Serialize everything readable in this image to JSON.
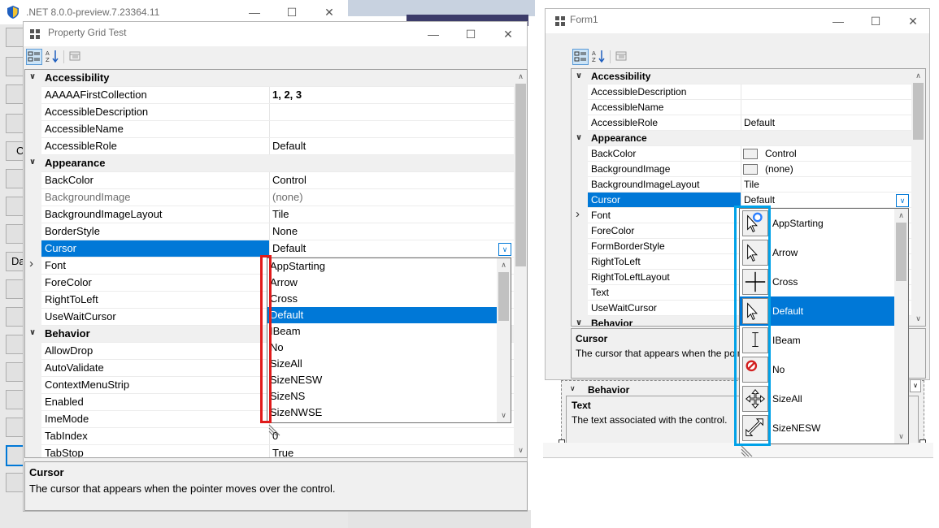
{
  "bg_window": {
    "title": ".NET 8.0.0-preview.7.23364.11",
    "partial_text_1": "C",
    "partial_text_2": "Da"
  },
  "left_window": {
    "title": "Property Grid Test",
    "rows": [
      {
        "type": "cat",
        "name": "Accessibility",
        "expanded": true
      },
      {
        "name": "AAAAAFirstCollection",
        "value": "1, 2, 3",
        "bold": true
      },
      {
        "name": "AccessibleDescription",
        "value": ""
      },
      {
        "name": "AccessibleName",
        "value": ""
      },
      {
        "name": "AccessibleRole",
        "value": "Default"
      },
      {
        "type": "cat",
        "name": "Appearance",
        "expanded": true
      },
      {
        "name": "BackColor",
        "value": "Control"
      },
      {
        "name": "BackgroundImage",
        "value": "(none)",
        "grey": true
      },
      {
        "name": "BackgroundImageLayout",
        "value": "Tile"
      },
      {
        "name": "BorderStyle",
        "value": "None"
      },
      {
        "name": "Cursor",
        "value": "Default",
        "selected": true
      },
      {
        "name": "Font",
        "value": "",
        "expandable": true
      },
      {
        "name": "ForeColor",
        "value": ""
      },
      {
        "name": "RightToLeft",
        "value": ""
      },
      {
        "name": "UseWaitCursor",
        "value": ""
      },
      {
        "type": "cat",
        "name": "Behavior",
        "expanded": true
      },
      {
        "name": "AllowDrop",
        "value": ""
      },
      {
        "name": "AutoValidate",
        "value": ""
      },
      {
        "name": "ContextMenuStrip",
        "value": ""
      },
      {
        "name": "Enabled",
        "value": ""
      },
      {
        "name": "ImeMode",
        "value": ""
      },
      {
        "name": "TabIndex",
        "value": "0"
      },
      {
        "name": "TabStop",
        "value": "True"
      }
    ],
    "dropdown_items": [
      "AppStarting",
      "Arrow",
      "Cross",
      "Default",
      "IBeam",
      "No",
      "SizeAll",
      "SizeNESW",
      "SizeNS",
      "SizeNWSE"
    ],
    "dropdown_selected": 3,
    "desc_title": "Cursor",
    "desc_text": "The cursor that appears when the pointer moves over the control."
  },
  "right_window": {
    "title": "Form1",
    "rows": [
      {
        "type": "cat",
        "name": "Accessibility",
        "expanded": true
      },
      {
        "name": "AccessibleDescription",
        "value": ""
      },
      {
        "name": "AccessibleName",
        "value": ""
      },
      {
        "name": "AccessibleRole",
        "value": "Default"
      },
      {
        "type": "cat",
        "name": "Appearance",
        "expanded": true
      },
      {
        "name": "BackColor",
        "value": "Control",
        "swatch": true
      },
      {
        "name": "BackgroundImage",
        "value": "(none)",
        "swatch": true
      },
      {
        "name": "BackgroundImageLayout",
        "value": "Tile"
      },
      {
        "name": "Cursor",
        "value": "Default",
        "selected": true
      },
      {
        "name": "Font",
        "value": "",
        "expandable": true
      },
      {
        "name": "ForeColor",
        "value": ""
      },
      {
        "name": "FormBorderStyle",
        "value": ""
      },
      {
        "name": "RightToLeft",
        "value": ""
      },
      {
        "name": "RightToLeftLayout",
        "value": ""
      },
      {
        "name": "Text",
        "value": ""
      },
      {
        "name": "UseWaitCursor",
        "value": ""
      },
      {
        "type": "cat",
        "name": "Behavior",
        "expanded": true
      }
    ],
    "dropdown_items": [
      {
        "label": "AppStarting",
        "icon": "cursor-appstarting-icon"
      },
      {
        "label": "Arrow",
        "icon": "cursor-arrow-icon"
      },
      {
        "label": "Cross",
        "icon": "cursor-cross-icon"
      },
      {
        "label": "Default",
        "icon": "cursor-default-icon"
      },
      {
        "label": "IBeam",
        "icon": "cursor-ibeam-icon"
      },
      {
        "label": "No",
        "icon": "cursor-no-icon"
      },
      {
        "label": "SizeAll",
        "icon": "cursor-sizeall-icon"
      },
      {
        "label": "SizeNESW",
        "icon": "cursor-sizenesw-icon"
      }
    ],
    "dropdown_selected": 3,
    "desc_title": "Cursor",
    "desc_text": "The cursor that appears when the poin",
    "designer_behavior": "Behavior",
    "designer_desc_title": "Text",
    "designer_desc_text": "The text associated with the control."
  },
  "colors": {
    "selection": "#0078d7",
    "highlight_red": "#e01b1b",
    "highlight_blue": "#00a2e8"
  }
}
